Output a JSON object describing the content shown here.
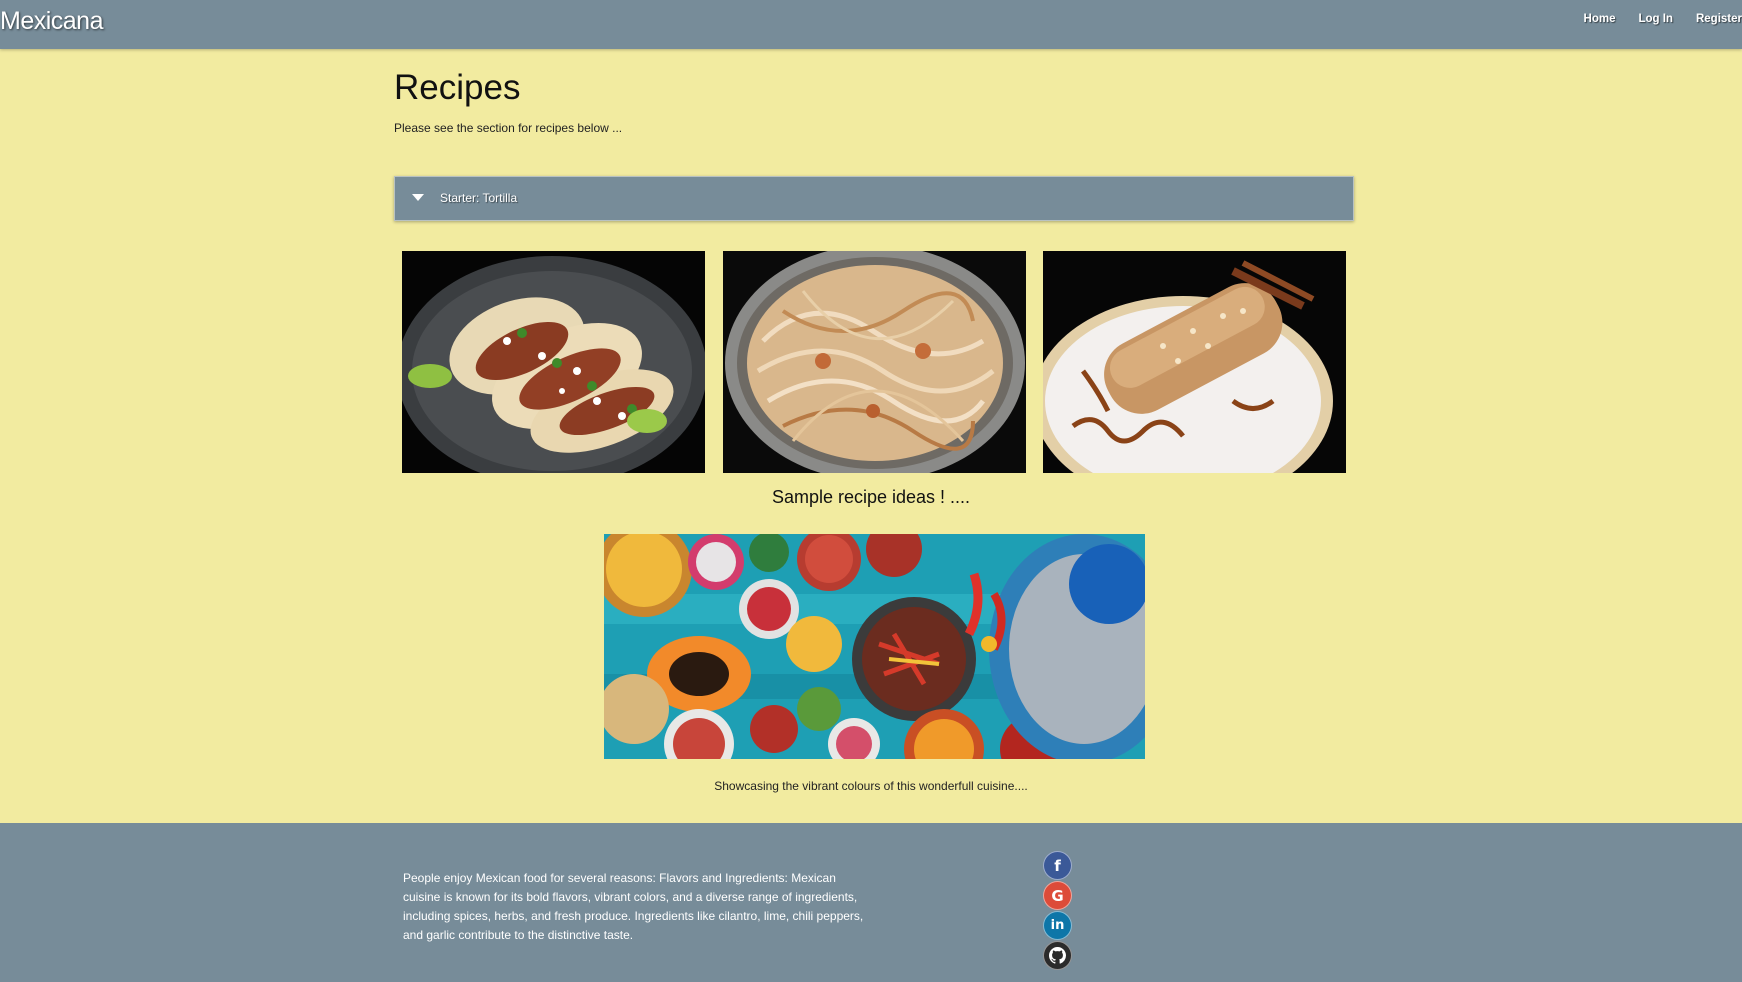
{
  "nav": {
    "brand": "Mexicana",
    "links": [
      "Home",
      "Log In",
      "Register"
    ]
  },
  "main": {
    "title": "Recipes",
    "intro": "Please see the section for recipes below ...",
    "accordion_label": "Starter: Tortilla",
    "gallery_caption": "Sample recipe ideas ! ....",
    "hero_caption": "Showcasing the vibrant colours of this wonderfull cuisine...."
  },
  "footer": {
    "text": "People enjoy Mexican food for several reasons: Flavors and Ingredients: Mexican cuisine is known for its bold flavors, vibrant colors, and a diverse range of ingredients, including spices, herbs, and fresh produce. Ingredients like cilantro, lime, chili peppers, and garlic contribute to the distinctive taste.",
    "social_icons": [
      "facebook-icon",
      "google-icon",
      "linkedin-icon",
      "github-icon"
    ]
  },
  "colors": {
    "page_background": "#f2eba0",
    "navbar": "#778c99",
    "footer": "#778c99"
  }
}
